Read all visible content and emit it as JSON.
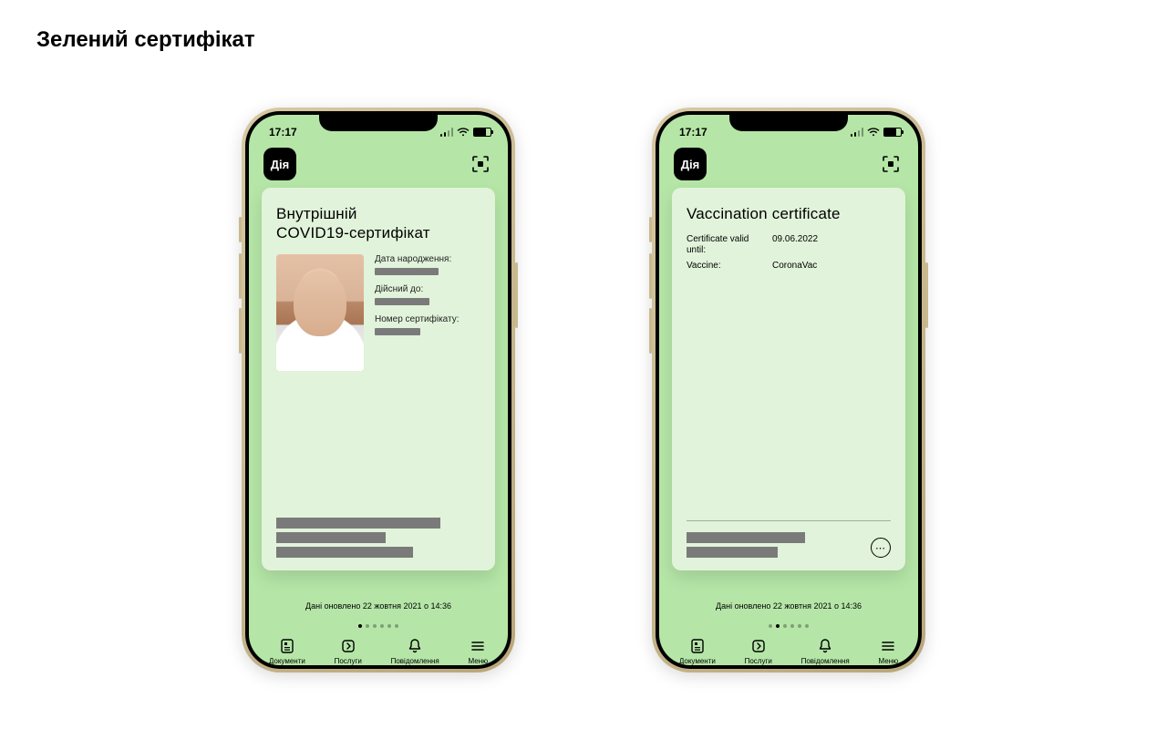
{
  "page": {
    "title": "Зелений сертифікат"
  },
  "status": {
    "time": "17:17"
  },
  "app": {
    "logo": "Дія"
  },
  "updated_text": "Дані оновлено 22 жовтня 2021 о 14:36",
  "tabs": {
    "documents": "Документи",
    "services": "Послуги",
    "notifications": "Повідомлення",
    "menu": "Меню"
  },
  "phone_a": {
    "card_title_line1": "Внутрішній",
    "card_title_line2": "COVID19-сертифікат",
    "fields": {
      "dob_label": "Дата народження:",
      "valid_label": "Дійсний до:",
      "certno_label": "Номер сертифікату:"
    }
  },
  "phone_b": {
    "card_title": "Vaccination certificate",
    "rows": {
      "valid_label": "Certificate valid until:",
      "valid_value": "09.06.2022",
      "vaccine_label": "Vaccine:",
      "vaccine_value": "CoronaVac"
    }
  }
}
